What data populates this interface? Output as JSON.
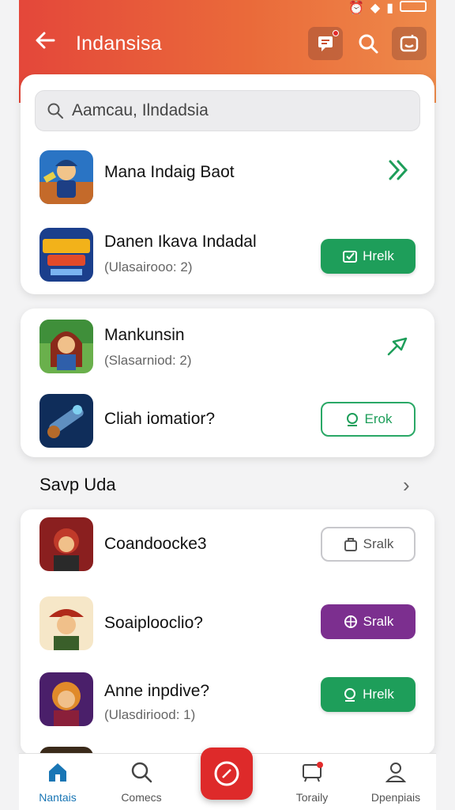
{
  "header": {
    "title": "Indansisa"
  },
  "search": {
    "placeholder": "Aamcau, Ilndadsia"
  },
  "card1": {
    "items": [
      {
        "title": "Mana Indaig Baot",
        "subtitle": "",
        "action": "chevron"
      },
      {
        "title": "Danen Ikava Indadal",
        "subtitle": "(Ulasairooo: 2)",
        "action_label": "Hrelk"
      }
    ]
  },
  "card2": {
    "items": [
      {
        "title": "Mankunsin",
        "subtitle": "(Slasarniod: 2)",
        "action": "pin"
      },
      {
        "title": "Cliah iomatior?",
        "subtitle": "",
        "action_label": "Erok"
      }
    ]
  },
  "section": {
    "title": "Savp Uda"
  },
  "list3": {
    "items": [
      {
        "title": "Coandoocke3",
        "subtitle": "",
        "action_label": "Sralk"
      },
      {
        "title": "Soaiplooclio?",
        "subtitle": "",
        "action_label": "Sralk"
      },
      {
        "title": "Anne inpdive?",
        "subtitle": "(Ulasdiriood: 1)",
        "action_label": "Hrelk"
      }
    ]
  },
  "nav": {
    "items": [
      {
        "label": "Nantais"
      },
      {
        "label": "Comecs"
      },
      {
        "label": "Toraily"
      },
      {
        "label": "Dpenpiais"
      }
    ]
  },
  "colors": {
    "header_start": "#e4473a",
    "header_end": "#ee8a4a",
    "green": "#1e9e5a",
    "purple": "#7c2f8f",
    "fab_red": "#de2a2a",
    "nav_active": "#1976b5"
  }
}
